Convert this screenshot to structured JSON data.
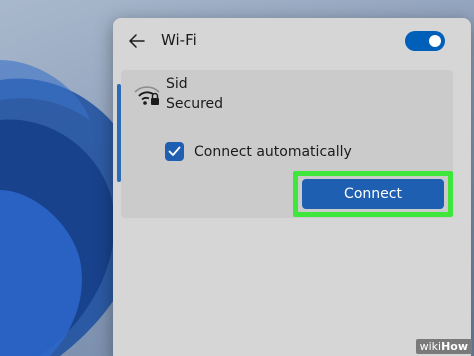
{
  "panel": {
    "title": "Wi-Fi",
    "wifi_enabled": true
  },
  "network": {
    "ssid": "Sid",
    "security": "Secured",
    "connect_automatically": true,
    "connect_automatically_label": "Connect automatically",
    "connect_label": "Connect"
  },
  "watermark": {
    "part1": "wiki",
    "part2": "How"
  },
  "icons": {
    "back": "back-arrow-icon",
    "wifi": "wifi-secured-icon",
    "check": "check-icon"
  },
  "colors": {
    "accent": "#1f5fb2",
    "highlight": "#3ee73a",
    "panel_bg": "#d6d6d6"
  }
}
